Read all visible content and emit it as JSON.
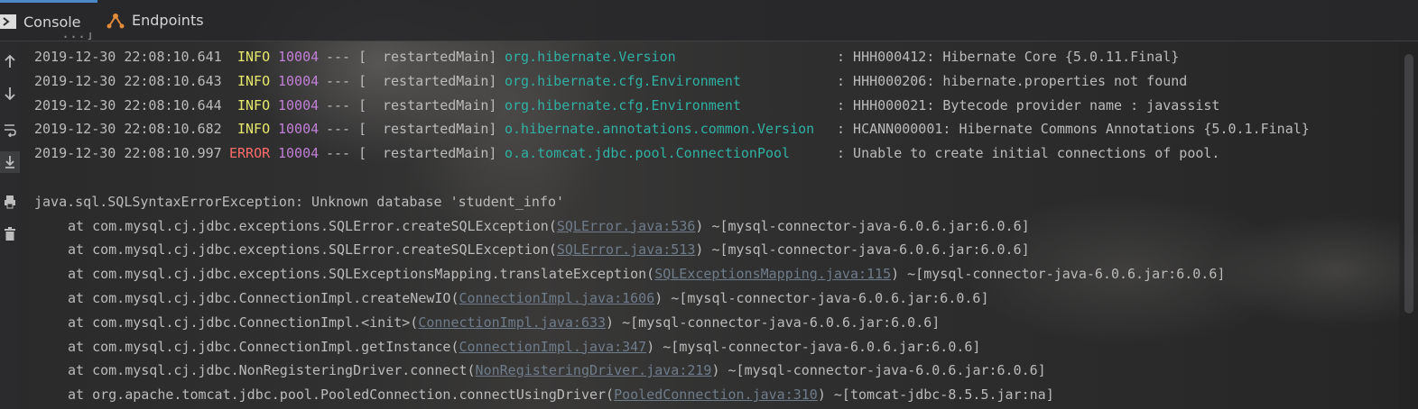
{
  "tabs": [
    {
      "label": "Console",
      "icon": "console-icon",
      "active": true
    },
    {
      "label": "Endpoints",
      "icon": "endpoints-icon",
      "active": false
    }
  ],
  "toolbar": {
    "tools": [
      "up-arrow-icon",
      "down-arrow-icon",
      "soft-wrap-icon",
      "scroll-to-end-icon",
      "print-icon",
      "trash-icon"
    ]
  },
  "console": {
    "ellipsis": "...]",
    "logs": [
      {
        "timestamp": "2019-12-30 22:08:10.641",
        "level": "INFO",
        "pid": "10004",
        "sep": "--- [",
        "thread": "restartedMain]",
        "logger": "org.hibernate.Version",
        "message": ": HHH000412: Hibernate Core {5.0.11.Final}"
      },
      {
        "timestamp": "2019-12-30 22:08:10.643",
        "level": "INFO",
        "pid": "10004",
        "sep": "--- [",
        "thread": "restartedMain]",
        "logger": "org.hibernate.cfg.Environment",
        "message": ": HHH000206: hibernate.properties not found"
      },
      {
        "timestamp": "2019-12-30 22:08:10.644",
        "level": "INFO",
        "pid": "10004",
        "sep": "--- [",
        "thread": "restartedMain]",
        "logger": "org.hibernate.cfg.Environment",
        "message": ": HHH000021: Bytecode provider name : javassist"
      },
      {
        "timestamp": "2019-12-30 22:08:10.682",
        "level": "INFO",
        "pid": "10004",
        "sep": "--- [",
        "thread": "restartedMain]",
        "logger": "o.hibernate.annotations.common.Version",
        "message": ": HCANN000001: Hibernate Commons Annotations {5.0.1.Final}"
      },
      {
        "timestamp": "2019-12-30 22:08:10.997",
        "level": "ERROR",
        "pid": "10004",
        "sep": "--- [",
        "thread": "restartedMain]",
        "logger": "o.a.tomcat.jdbc.pool.ConnectionPool",
        "message": ": Unable to create initial connections of pool."
      }
    ],
    "exception": "java.sql.SQLSyntaxErrorException: Unknown database 'student_info'",
    "stack": [
      {
        "prefix": "at com.mysql.cj.jdbc.exceptions.SQLError.createSQLException(",
        "link": "SQLError.java:536",
        "suffix": ") ~[mysql-connector-java-6.0.6.jar:6.0.6]"
      },
      {
        "prefix": "at com.mysql.cj.jdbc.exceptions.SQLError.createSQLException(",
        "link": "SQLError.java:513",
        "suffix": ") ~[mysql-connector-java-6.0.6.jar:6.0.6]"
      },
      {
        "prefix": "at com.mysql.cj.jdbc.exceptions.SQLExceptionsMapping.translateException(",
        "link": "SQLExceptionsMapping.java:115",
        "suffix": ") ~[mysql-connector-java-6.0.6.jar:6.0.6]"
      },
      {
        "prefix": "at com.mysql.cj.jdbc.ConnectionImpl.createNewIO(",
        "link": "ConnectionImpl.java:1606",
        "suffix": ") ~[mysql-connector-java-6.0.6.jar:6.0.6]"
      },
      {
        "prefix": "at com.mysql.cj.jdbc.ConnectionImpl.<init>(",
        "link": "ConnectionImpl.java:633",
        "suffix": ") ~[mysql-connector-java-6.0.6.jar:6.0.6]"
      },
      {
        "prefix": "at com.mysql.cj.jdbc.ConnectionImpl.getInstance(",
        "link": "ConnectionImpl.java:347",
        "suffix": ") ~[mysql-connector-java-6.0.6.jar:6.0.6]"
      },
      {
        "prefix": "at com.mysql.cj.jdbc.NonRegisteringDriver.connect(",
        "link": "NonRegisteringDriver.java:219",
        "suffix": ") ~[mysql-connector-java-6.0.6.jar:6.0.6]"
      },
      {
        "prefix": "at org.apache.tomcat.jdbc.pool.PooledConnection.connectUsingDriver(",
        "link": "PooledConnection.java:310",
        "suffix": ") ~[tomcat-jdbc-8.5.5.jar:na]"
      }
    ]
  },
  "colors": {
    "info": "#e6e86b",
    "error": "#ff6b68",
    "pid": "#c17fd7",
    "logger": "#2fb1a3",
    "link": "#6f7c8a",
    "text": "#bbbbbb",
    "accent": "#4a88c7"
  }
}
